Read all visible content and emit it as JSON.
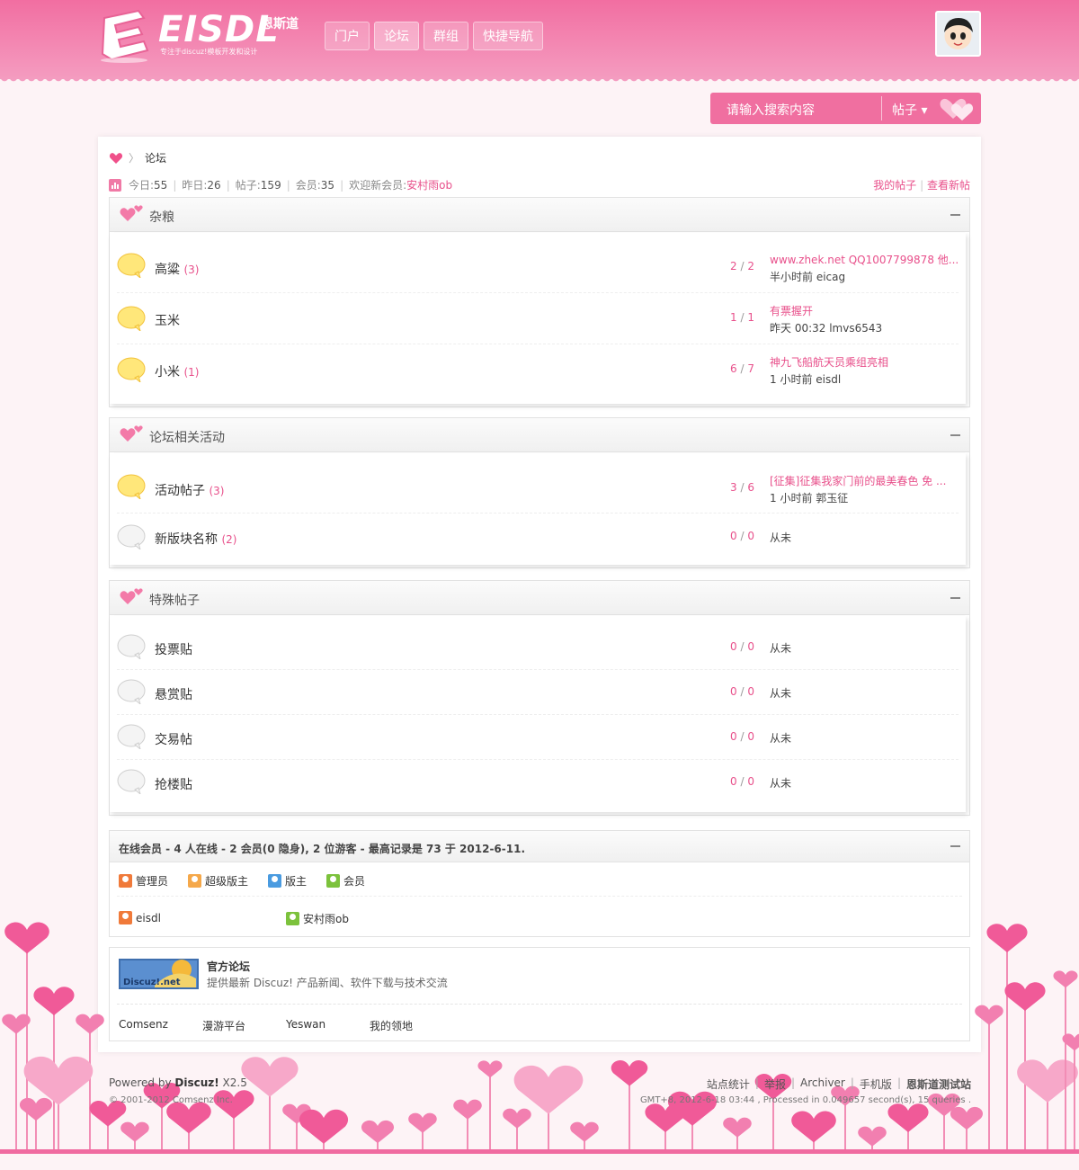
{
  "header": {
    "logo_text": "EISDL",
    "logo_cn": "恩斯道",
    "logo_sub": "专注于discuz!模板开发和设计",
    "nav": [
      "门户",
      "论坛",
      "群组",
      "快捷导航"
    ]
  },
  "search": {
    "placeholder": "请输入搜索内容",
    "type": "帖子"
  },
  "breadcrumb": {
    "current": "论坛"
  },
  "stats": {
    "today_label": "今日: ",
    "today": "55",
    "yesterday_label": "昨日: ",
    "yesterday": "26",
    "posts_label": "帖子: ",
    "posts": "159",
    "members_label": "会员: ",
    "members": "35",
    "welcome_label": "欢迎新会员: ",
    "newest": "安村雨ob"
  },
  "top_links": [
    "我的帖子",
    "查看新帖"
  ],
  "categories": [
    {
      "title": "杂粮",
      "forums": [
        {
          "name": "高粱",
          "today": "(3)",
          "threads": "2",
          "posts": "2",
          "last_title": "www.zhek.net QQ1007799878 他...",
          "last_meta": "半小时前 eicag"
        },
        {
          "name": "玉米",
          "today": "",
          "threads": "1",
          "posts": "1",
          "last_title": "有票握开",
          "last_meta": "昨天 00:32 lmvs6543"
        },
        {
          "name": "小米",
          "today": "(1)",
          "threads": "6",
          "posts": "7",
          "last_title": "神九飞船航天员乘组亮相",
          "last_meta": "1 小时前 eisdl"
        }
      ]
    },
    {
      "title": "论坛相关活动",
      "forums": [
        {
          "name": "活动帖子",
          "today": "(3)",
          "threads": "3",
          "posts": "6",
          "last_title": "[征集]征集我家门前的最美春色 免 ...",
          "last_meta": "1 小时前 郭玉征"
        },
        {
          "name": "新版块名称",
          "today": "(2)",
          "threads": "0",
          "posts": "0",
          "never": "从未"
        }
      ]
    },
    {
      "title": "特殊帖子",
      "forums": [
        {
          "name": "投票贴",
          "threads": "0",
          "posts": "0",
          "never": "从未"
        },
        {
          "name": "悬赏贴",
          "threads": "0",
          "posts": "0",
          "never": "从未"
        },
        {
          "name": "交易帖",
          "threads": "0",
          "posts": "0",
          "never": "从未"
        },
        {
          "name": "抢楼贴",
          "threads": "0",
          "posts": "0",
          "never": "从未"
        }
      ]
    }
  ],
  "online": {
    "title": "在线会员 - 4 人在线 - 2 会员(0 隐身), 2 位游客 - 最高记录是 73 于 2012-6-11.",
    "legend": [
      "管理员",
      "超级版主",
      "版主",
      "会员"
    ],
    "legend_colors": [
      "#f07a3a",
      "#f5a84a",
      "#4a9be0",
      "#7cc23c"
    ],
    "users": [
      "eisdl",
      "安村雨ob"
    ]
  },
  "links": {
    "logo_text": "Discuz!.net",
    "name": "官方论坛",
    "desc": "提供最新 Discuz! 产品新闻、软件下载与技术交流",
    "text_links": [
      "Comsenz",
      "漫游平台",
      "Yeswan",
      "我的领地"
    ]
  },
  "footer": {
    "powered": "Powered by ",
    "product": "Discuz!",
    "version": " X2.5",
    "copyright": "© 2001-2012 Comsenz Inc.",
    "links": [
      "站点统计",
      "举报",
      "Archiver",
      "手机版",
      "恩斯道测试站"
    ],
    "process": "GMT+8, 2012-6-18 03:44 , Processed in 0.049657 second(s), 15 queries ."
  },
  "colors": {
    "accent": "#f26ea1",
    "link": "#e8508b"
  }
}
